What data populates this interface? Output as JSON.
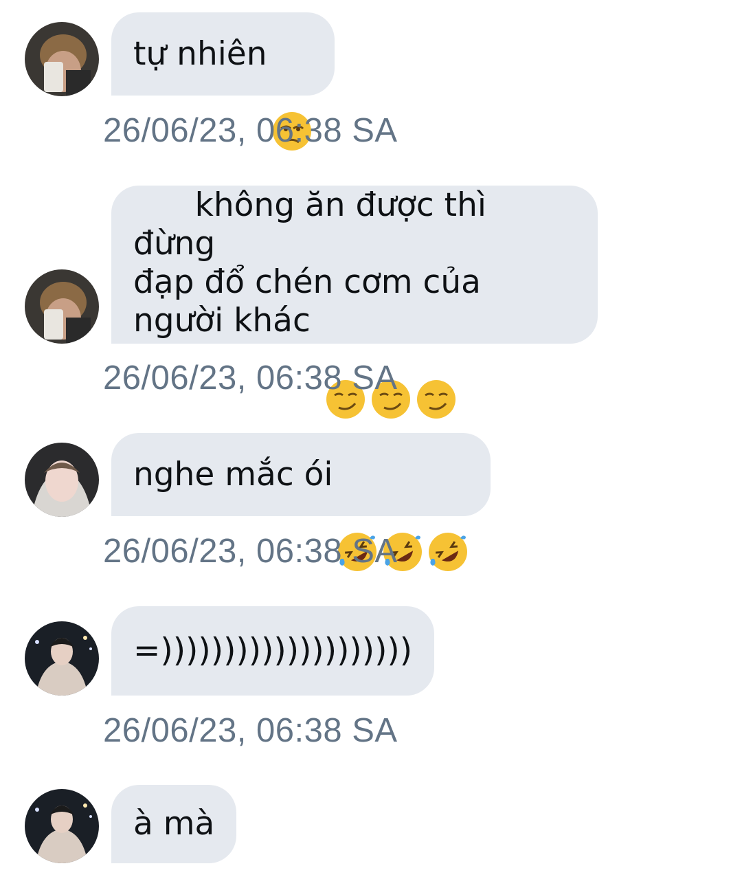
{
  "messages": [
    {
      "text": "tự nhiên",
      "emoji": [
        "unamused-face-emoji"
      ],
      "time": "26/06/23, 06:38 SA",
      "avatar": "mirror-selfie-avatar"
    },
    {
      "text": "không ăn được thì đừng\nđạp đổ chén cơm của\nngười khác ",
      "emoji": [
        "smirking-face-emoji",
        "smirking-face-emoji",
        "smirking-face-emoji"
      ],
      "time": "26/06/23, 06:38 SA",
      "avatar": "mirror-selfie-avatar"
    },
    {
      "text": "nghe mắc ói",
      "emoji": [
        "rofl-face-emoji",
        "rofl-face-emoji",
        "rofl-face-emoji"
      ],
      "time": "26/06/23, 06:38 SA",
      "avatar": "hoodie-portrait-avatar"
    },
    {
      "text": "=))))))))))))))))))))",
      "emoji": [],
      "time": "26/06/23, 06:38 SA",
      "avatar": "night-street-avatar"
    },
    {
      "text": "à mà",
      "emoji": [],
      "time": "",
      "avatar": "night-street-avatar"
    }
  ],
  "colors": {
    "bubble": "#e5e9ef",
    "timestamp": "#637486",
    "text": "#0e1114"
  }
}
